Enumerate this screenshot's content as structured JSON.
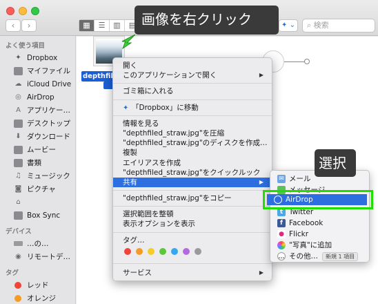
{
  "window": {
    "nav_back": "‹",
    "nav_forward": "›",
    "search_placeholder": "検索",
    "view_icons": [
      "▦",
      "☰",
      "▥",
      "▤"
    ],
    "dropbox_label": "✦ ⌄"
  },
  "sidebar": {
    "favorites_header": "よく使う項目",
    "favorites": [
      {
        "label": "Dropbox",
        "icon": "dropbox-icon"
      },
      {
        "label": "マイファイル",
        "icon": "my-files-icon"
      },
      {
        "label": "iCloud Drive",
        "icon": "icloud-icon"
      },
      {
        "label": "AirDrop",
        "icon": "airdrop-icon"
      },
      {
        "label": "アプリケー…",
        "icon": "applications-icon"
      },
      {
        "label": "デスクトップ",
        "icon": "desktop-icon"
      },
      {
        "label": "ダウンロード",
        "icon": "downloads-icon"
      },
      {
        "label": "ムービー",
        "icon": "movies-icon"
      },
      {
        "label": "書類",
        "icon": "documents-icon"
      },
      {
        "label": "ミュージック",
        "icon": "music-icon"
      },
      {
        "label": "ピクチャ",
        "icon": "pictures-icon"
      },
      {
        "label": "",
        "icon": "home-icon"
      },
      {
        "label": "Box Sync",
        "icon": "folder-icon"
      }
    ],
    "devices_header": "デバイス",
    "devices": [
      {
        "label": "…の…",
        "icon": "laptop-icon"
      },
      {
        "label": "リモートデ…",
        "icon": "remote-disc-icon"
      }
    ],
    "tags_header": "タグ",
    "tags": [
      {
        "label": "レッド",
        "color": "#f0443a"
      },
      {
        "label": "オレンジ",
        "color": "#f59a23"
      }
    ]
  },
  "file": {
    "name_line1": "depthfiled_st",
    "thumbnail": "photo-thumbnail"
  },
  "callouts": {
    "right_click": "画像を右クリック",
    "select": "選択"
  },
  "context_menu": {
    "open": "開く",
    "open_with": "このアプリケーションで開く",
    "trash": "ゴミ箱に入れる",
    "move_dropbox": "「Dropbox」に移動",
    "get_info": "情報を見る",
    "compress": "\"depthfiled_straw.jpg\"を圧縮",
    "burn": "\"depthfiled_straw.jpg\"のディスクを作成…",
    "duplicate": "複製",
    "alias": "エイリアスを作成",
    "quicklook": "\"depthfiled_straw.jpg\"をクイックルック",
    "share": "共有",
    "copy": "\"depthfiled_straw.jpg\"をコピー",
    "cleanup": "選択範囲を整頓",
    "view_options": "表示オプションを表示",
    "tags": "タグ…",
    "tag_colors": [
      "#f0443a",
      "#f59a23",
      "#f5cc28",
      "#5ac83a",
      "#35a8f0",
      "#b36ae0",
      "#9a9a9a"
    ],
    "services": "サービス"
  },
  "share_menu": {
    "mail": "メール",
    "messages": "メッセージ",
    "airdrop": "AirDrop",
    "twitter": "Twitter",
    "facebook": "Facebook",
    "flickr": "Flickr",
    "photos": "\"写真\"に追加",
    "other": "その他…",
    "badge": "新規 1 項目"
  }
}
